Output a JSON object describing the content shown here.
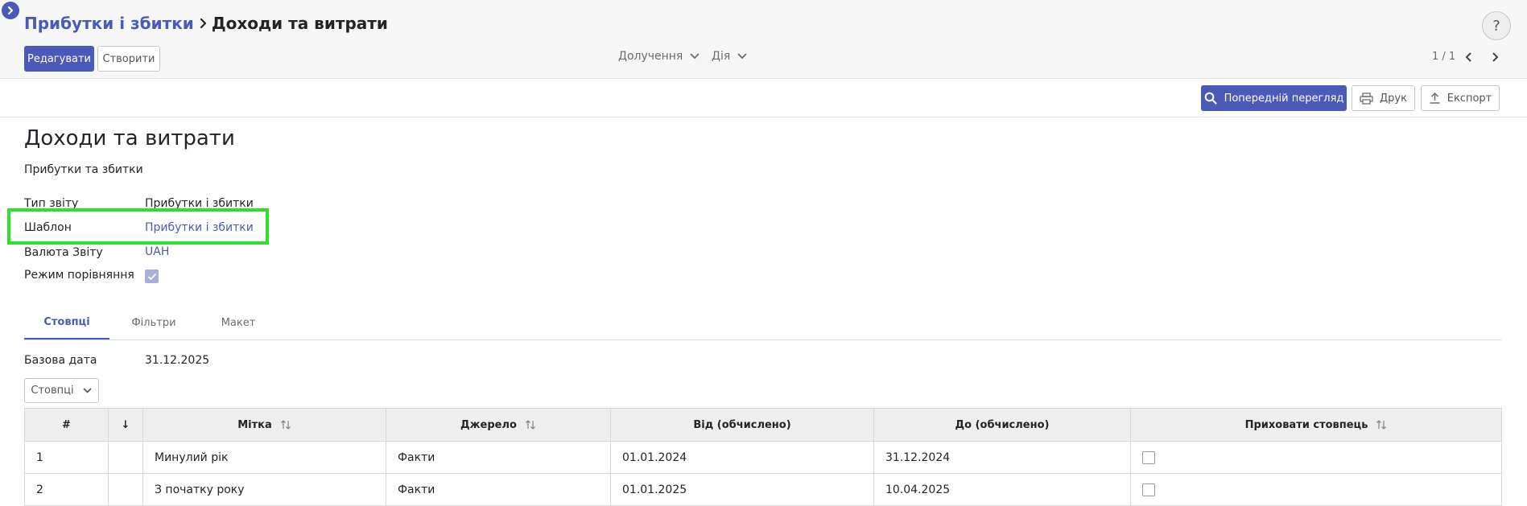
{
  "breadcrumb": {
    "parent": "Прибутки і збитки",
    "current": "Доходи та витрати"
  },
  "toolbar": {
    "edit_label": "Редагувати",
    "create_label": "Створити",
    "attachments_label": "Долучення",
    "action_label": "Дія",
    "pager_text": "1 / 1"
  },
  "report_actions": {
    "preview_label": "Попередній перегляд",
    "print_label": "Друк",
    "export_label": "Експорт"
  },
  "record": {
    "title": "Доходи та витрати",
    "subtitle": "Прибутки та збитки",
    "fields": {
      "report_type_label": "Тип звіту",
      "report_type_value": "Прибутки і збитки",
      "template_label": "Шаблон",
      "template_value": "Прибутки і збитки",
      "currency_label": "Валюта Звіту",
      "currency_value": "UAH",
      "comparison_label": "Режим порівняння",
      "comparison_checked": true
    }
  },
  "tabs": [
    {
      "label": "Стовпці",
      "active": true
    },
    {
      "label": "Фільтри",
      "active": false
    },
    {
      "label": "Макет",
      "active": false
    }
  ],
  "columns_tab": {
    "base_date_label": "Базова дата",
    "base_date_value": "31.12.2025",
    "columns_dropdown_label": "Стовпці",
    "table": {
      "headers": [
        "#",
        "↓",
        "Мітка",
        "Джерело",
        "Від (обчислено)",
        "До (обчислено)",
        "Приховати стовпець"
      ],
      "rows": [
        {
          "num": "1",
          "label": "Минулий рік",
          "source": "Факти",
          "from": "01.01.2024",
          "to": "31.12.2024",
          "hidden": false
        },
        {
          "num": "2",
          "label": "З початку року",
          "source": "Факти",
          "from": "01.01.2025",
          "to": "10.04.2025",
          "hidden": false
        }
      ]
    }
  },
  "colors": {
    "accent": "#4b5ab9",
    "highlight": "#2fe02a"
  }
}
